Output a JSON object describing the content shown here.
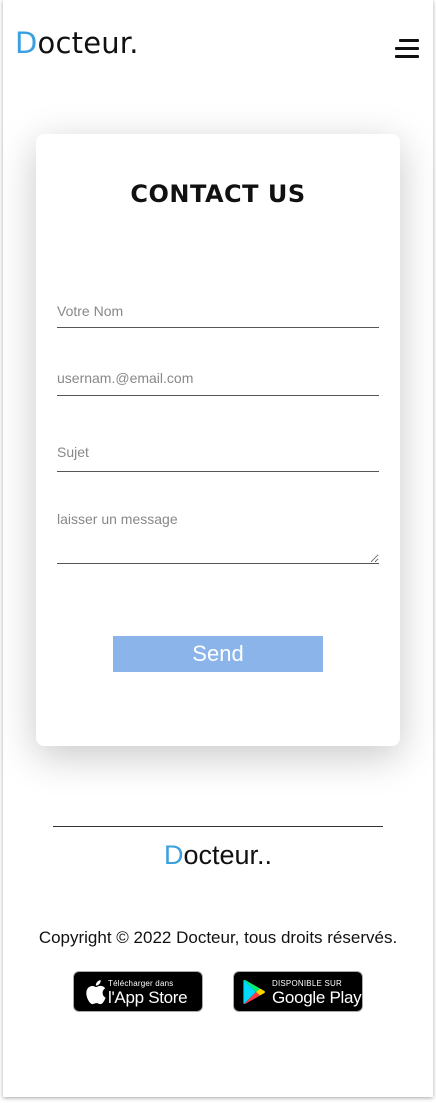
{
  "header": {
    "brand_initial": "D",
    "brand_rest": "octeur.",
    "menu_icon": "hamburger-menu-icon"
  },
  "contact": {
    "title": "CONTACT US",
    "name_placeholder": "Votre Nom",
    "email_placeholder": "usernam.@email.com",
    "subject_placeholder": "Sujet",
    "message_placeholder": "laisser un message",
    "send_label": "Send"
  },
  "footer": {
    "brand_initial": "D",
    "brand_rest": "octeur..",
    "copyright": "Copyright © 2022 Docteur, tous droits réservés.",
    "app_store": {
      "small": "Télécharger dans",
      "big": "l'App Store",
      "icon": "apple-icon"
    },
    "google_play": {
      "small": "DISPONIBLE SUR",
      "big": "Google Play",
      "icon": "google-play-icon"
    }
  },
  "colors": {
    "accent": "#3aa0e0",
    "button": "#8ab4ea",
    "text": "#111111"
  }
}
